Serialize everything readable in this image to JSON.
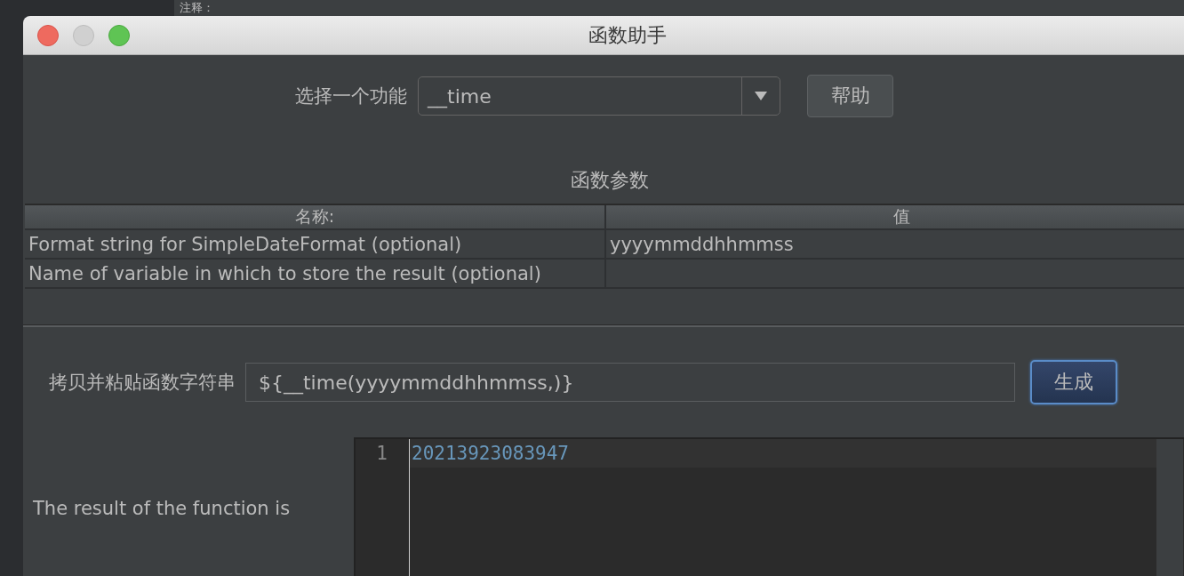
{
  "background": {
    "label": "注释："
  },
  "window": {
    "title": "函数助手"
  },
  "function_select": {
    "label": "选择一个功能",
    "value": "__time"
  },
  "help_button": "帮助",
  "parameters": {
    "title": "函数参数",
    "columns": [
      "名称:",
      "值"
    ],
    "rows": [
      {
        "name": "Format string for SimpleDateFormat (optional)",
        "value": "yyyymmddhhmmss"
      },
      {
        "name": "Name of variable in which to store the result (optional)"
      }
    ]
  },
  "copy_string": {
    "label": "拷贝并粘贴函数字符串",
    "value": "${__time(yyyymmddhhmmss,)}"
  },
  "generate_button": "生成",
  "result": {
    "label": "The result of the function is",
    "lines": [
      {
        "number": "1",
        "text": "20213923083947"
      }
    ]
  }
}
